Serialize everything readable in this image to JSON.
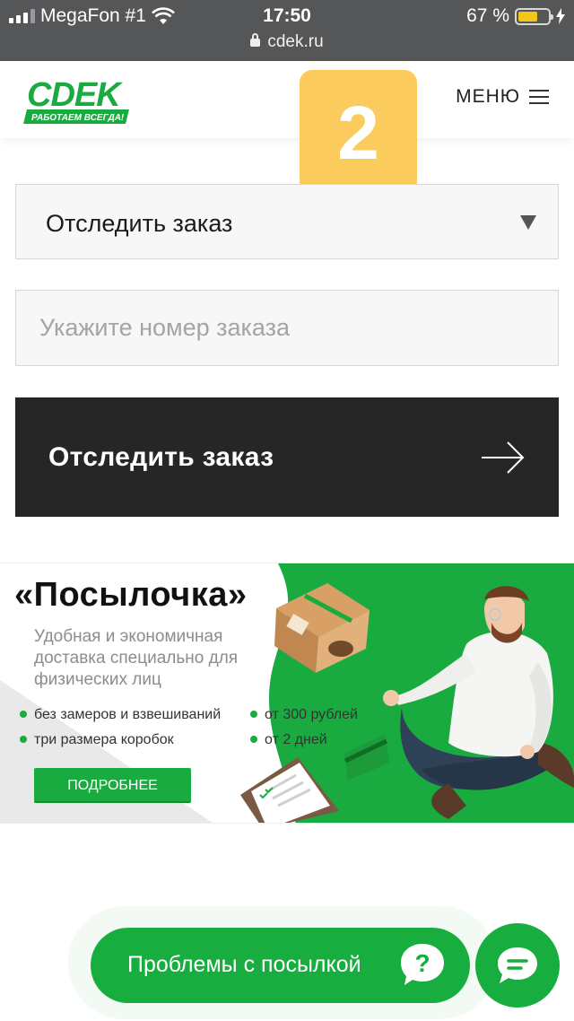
{
  "status_bar": {
    "carrier": "MegaFon #1",
    "time": "17:50",
    "url": "cdek.ru",
    "battery_text": "67 %",
    "battery_level": 0.67
  },
  "header": {
    "logo_text": "СDEK",
    "logo_tagline": "РАБОТАЕМ ВСЕГДА!",
    "menu_label": "МЕНЮ"
  },
  "overlay": {
    "step_number": "2"
  },
  "tracking": {
    "select_label": "Отследить заказ",
    "input_value": "",
    "input_placeholder": "Укажите номер заказа",
    "button_label": "Отследить заказ"
  },
  "banner": {
    "title": "«Посылочка»",
    "subtitle": "Удобная и экономичная доставка специально для физических лиц",
    "features": [
      "без замеров и взвешиваний",
      "три размера коробок",
      "от 300 рублей",
      "от 2 дней"
    ],
    "button_label": "ПОДРОБНЕЕ"
  },
  "bottom": {
    "help_label": "Проблемы с посылкой",
    "help_icon": "question-icon",
    "chat_icon": "chat-icon"
  },
  "colors": {
    "brand_green": "#17ad3f",
    "dark_button": "#262626",
    "step_badge": "#fccb5e",
    "status_bar": "#555658"
  }
}
